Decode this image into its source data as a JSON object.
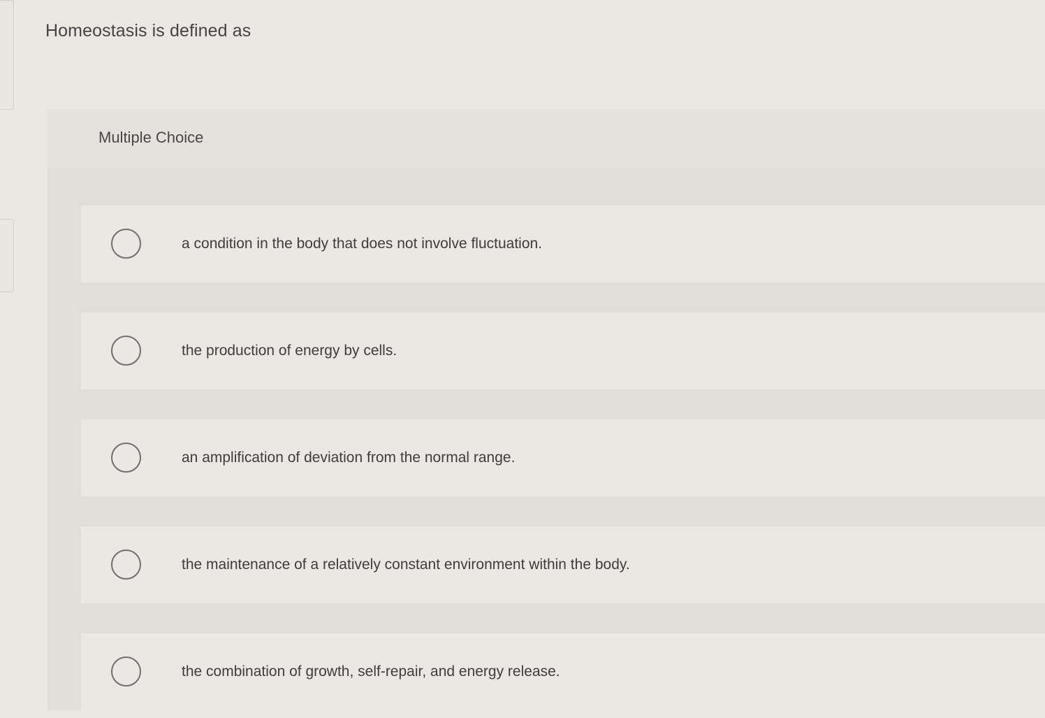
{
  "question": {
    "prompt": "Homeostasis is defined as"
  },
  "multiple_choice": {
    "label": "Multiple Choice",
    "options": [
      "a condition in the body that does not involve fluctuation.",
      "the production of energy by cells.",
      "an amplification of deviation from the normal range.",
      "the maintenance of a relatively constant environment within the body.",
      "the combination of growth, self-repair, and energy release."
    ],
    "selected_index": null
  },
  "colors": {
    "page_background": "#ebe8e4",
    "panel_background": "#e1deda",
    "option_background": "#ebe8e4",
    "text": "#3d3d3d",
    "radio_border": "#6f6f6f"
  }
}
